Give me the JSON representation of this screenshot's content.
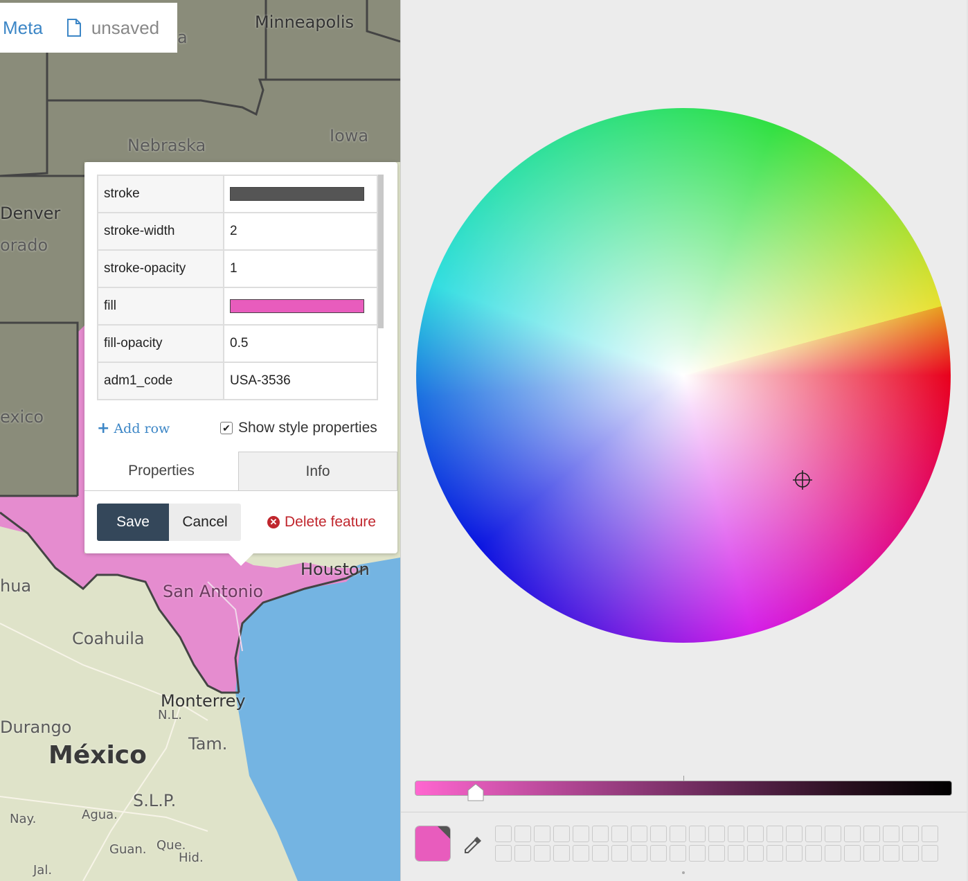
{
  "topbar": {
    "meta_label": "Meta",
    "file_icon": "document-icon",
    "status": "unsaved"
  },
  "map": {
    "labels": {
      "minneapolis": "Minneapolis",
      "nebraska": "Nebraska",
      "iowa": "Iowa",
      "denver": "Denver",
      "colorado": "orado",
      "mexico_state": "exico",
      "houston": "Houston",
      "san_antonio": "San Antonio",
      "chihuahua": "hua",
      "coahuila": "Coahuila",
      "monterrey": "Monterrey",
      "nl": "N.L.",
      "durango": "Durango",
      "tam": "Tam.",
      "mexico": "México",
      "slp": "S.L.P.",
      "nay": "Nay.",
      "agua": "Agua.",
      "guan": "Guan.",
      "que": "Que.",
      "hid": "Hid.",
      "jal": "Jal.",
      "ta": "a"
    },
    "colors": {
      "land": "#dfe3c9",
      "shaded": "#8a8c7a",
      "feature_fill": "#e58ccf",
      "water": "#74b4e2",
      "border": "#444444"
    }
  },
  "popup": {
    "rows": [
      {
        "key": "stroke",
        "value": "",
        "swatch": "#555555"
      },
      {
        "key": "stroke-width",
        "value": "2"
      },
      {
        "key": "stroke-opacity",
        "value": "1"
      },
      {
        "key": "fill",
        "value": "",
        "swatch": "#e85cbd"
      },
      {
        "key": "fill-opacity",
        "value": "0.5"
      },
      {
        "key": "adm1_code",
        "value": "USA-3536"
      }
    ],
    "add_row": "Add row",
    "show_style_label": "Show style properties",
    "show_style_checked": true,
    "tabs": [
      {
        "label": "Properties",
        "active": true
      },
      {
        "label": "Info",
        "active": false
      }
    ],
    "save_label": "Save",
    "cancel_label": "Cancel",
    "delete_label": "Delete feature"
  },
  "color_picker": {
    "selected_color": "#e85cbd",
    "brightness_fraction": 0.11,
    "eyedropper_icon": "eyedropper-icon",
    "swatch_rows": 2,
    "swatch_cols": 23
  }
}
